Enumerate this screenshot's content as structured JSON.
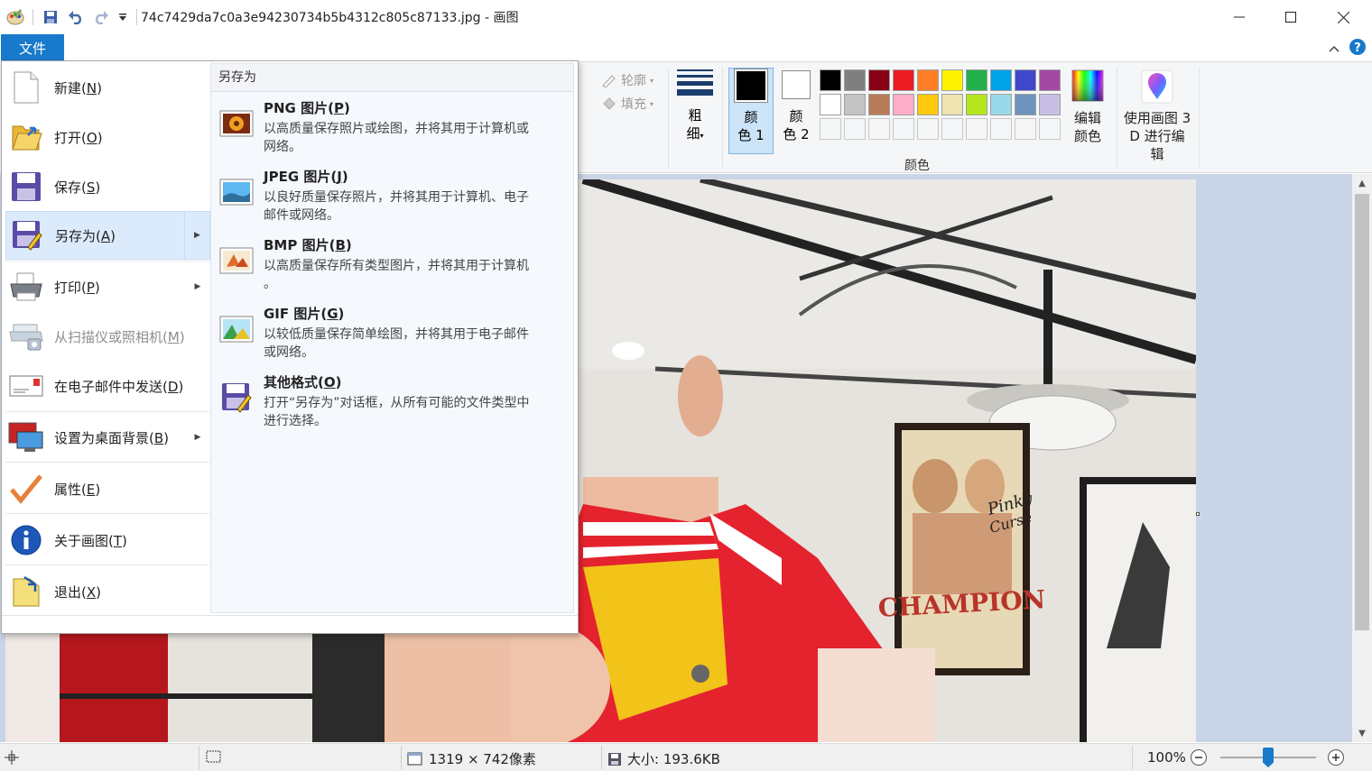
{
  "window": {
    "title": "74c7429da7c0a3e94230734b5b4312c805c87133.jpg - 画图",
    "minimize_icon": "minimize-icon",
    "maximize_icon": "maximize-icon",
    "close_icon": "close-icon"
  },
  "ribbon": {
    "file_tab": "文件",
    "outline_label": "轮廓",
    "fill_label": "填充",
    "size_label_1": "粗",
    "size_label_2": "细",
    "color1_label_1": "颜",
    "color1_label_2": "色 1",
    "color2_label_1": "颜",
    "color2_label_2": "色 2",
    "edit_colors_1": "编辑",
    "edit_colors_2": "颜色",
    "paint3d_1": "使用画图 3",
    "paint3d_2": "D 进行编辑",
    "colors_group": "颜色",
    "color1": "#000000",
    "color2": "#ffffff",
    "palette": [
      "#000000",
      "#7f7f7f",
      "#880015",
      "#ed1c24",
      "#ff7f27",
      "#fff200",
      "#22b14c",
      "#00a2e8",
      "#3f48cc",
      "#a349a4",
      "#ffffff",
      "#c3c3c3",
      "#b97a57",
      "#ffaec9",
      "#ffc90e",
      "#efe4b0",
      "#b5e61d",
      "#99d9ea",
      "#7092be",
      "#c8bfe7"
    ]
  },
  "file_menu": {
    "items": [
      {
        "label": "新建",
        "key": "N",
        "icon": "new-file-icon"
      },
      {
        "label": "打开",
        "key": "O",
        "icon": "open-folder-icon"
      },
      {
        "label": "保存",
        "key": "S",
        "icon": "save-icon"
      },
      {
        "label": "另存为",
        "key": "A",
        "icon": "save-as-icon"
      },
      {
        "label": "打印",
        "key": "P",
        "icon": "printer-icon"
      },
      {
        "label": "从扫描仪或照相机",
        "key": "M",
        "icon": "scanner-icon"
      },
      {
        "label": "在电子邮件中发送",
        "key": "D",
        "icon": "email-icon"
      },
      {
        "label": "设置为桌面背景",
        "key": "B",
        "icon": "desktop-background-icon"
      },
      {
        "label": "属性",
        "key": "E",
        "icon": "checkmark-icon"
      },
      {
        "label": "关于画图",
        "key": "T",
        "icon": "info-icon"
      },
      {
        "label": "退出",
        "key": "X",
        "icon": "exit-icon"
      }
    ],
    "save_as": {
      "title": "另存为",
      "options": [
        {
          "name": "PNG 图片",
          "key": "P",
          "desc_1": "以高质量保存照片或绘图，并将其用于计算机或",
          "desc_2": "网络。",
          "icon": "png-image-icon"
        },
        {
          "name": "JPEG 图片",
          "key": "J",
          "desc_1": "以良好质量保存照片，并将其用于计算机、电子",
          "desc_2": "邮件或网络。",
          "icon": "jpeg-image-icon"
        },
        {
          "name": "BMP 图片",
          "key": "B",
          "desc_1": "以高质量保存所有类型图片，并将其用于计算机",
          "desc_2": "。",
          "icon": "bmp-image-icon"
        },
        {
          "name": "GIF 图片",
          "key": "G",
          "desc_1": "以较低质量保存简单绘图，并将其用于电子邮件",
          "desc_2": "或网络。",
          "icon": "gif-image-icon"
        },
        {
          "name": "其他格式",
          "key": "O",
          "desc_1": "打开“另存为”对话框，从所有可能的文件类型中",
          "desc_2": "进行选择。",
          "icon": "other-formats-icon"
        }
      ]
    }
  },
  "status": {
    "dimensions": "1319 × 742像素",
    "size": "大小: 193.6KB",
    "zoom": "100%",
    "zoom_level": 0.5
  }
}
